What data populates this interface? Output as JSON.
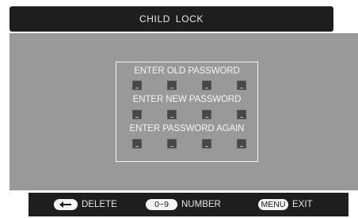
{
  "title": "CHILD  LOCK",
  "password_box": {
    "fields": [
      {
        "label": "ENTER OLD PASSWORD",
        "digits": 4
      },
      {
        "label": "ENTER NEW PASSWORD",
        "digits": 4
      },
      {
        "label": "ENTER PASSWORD AGAIN",
        "digits": 4
      }
    ]
  },
  "footer": {
    "delete": {
      "key_icon": "left-arrow-icon",
      "label": "DELETE"
    },
    "number": {
      "key_label": "0~9",
      "label": "NUMBER"
    },
    "exit": {
      "key_label": "MENU",
      "label": "EXIT"
    }
  },
  "colors": {
    "bar_background": "#1e1e1e",
    "panel_background": "#999999",
    "text": "#f4f4f4"
  }
}
